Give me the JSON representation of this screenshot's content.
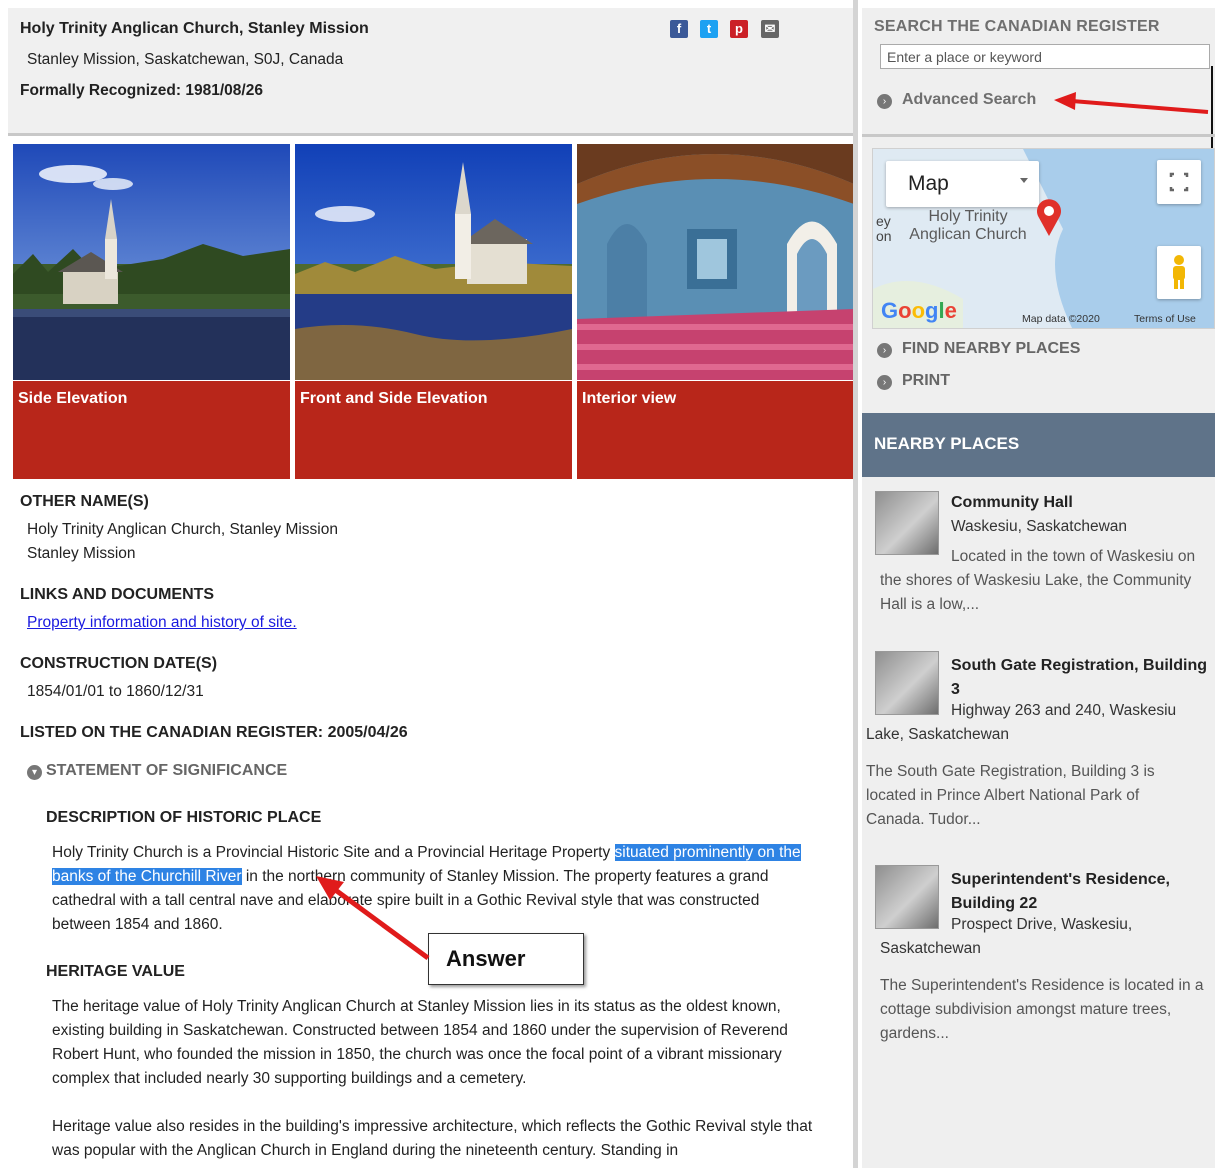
{
  "header": {
    "title": "Holy Trinity Anglican Church, Stanley Mission",
    "address": "Stanley Mission, Saskatchewan, S0J, Canada",
    "recognized": "Formally Recognized: 1981/08/26",
    "share_icons": [
      "facebook-icon",
      "twitter-icon",
      "pinterest-icon",
      "email-icon"
    ],
    "share_glyphs": {
      "facebook": "f",
      "twitter": "t",
      "pinterest": "p",
      "email": "✉"
    },
    "share_colors": {
      "facebook": "#3b5998",
      "twitter": "#1da1f2",
      "pinterest": "#cb2027",
      "email": "#666666"
    }
  },
  "images": [
    {
      "caption": "Side Elevation"
    },
    {
      "caption": "Front and Side Elevation"
    },
    {
      "caption": "Interior view"
    }
  ],
  "details": {
    "other_names_heading": "OTHER NAME(S)",
    "other_names": [
      "Holy Trinity Anglican Church, Stanley Mission",
      "Stanley Mission"
    ],
    "links_heading": "LINKS AND DOCUMENTS",
    "link_text": "Property information and history of site.",
    "construction_heading": "CONSTRUCTION DATE(S)",
    "construction_value": "1854/01/01 to 1860/12/31",
    "listed": "LISTED ON THE CANADIAN REGISTER: 2005/04/26",
    "statement_toggle": "STATEMENT OF SIGNIFICANCE",
    "description_heading": "DESCRIPTION OF HISTORIC PLACE",
    "description_before": "Holy Trinity Church is a Provincial Historic Site and a Provincial Heritage Property ",
    "description_highlight": "situated prominently on the banks of the Churchill River",
    "description_after": " in the northern community of Stanley Mission. The property features a grand cathedral with a tall central nave and elaborate spire built in a Gothic Revival style that was constructed between 1854 and 1860.",
    "heritage_heading": "HERITAGE VALUE",
    "heritage_p1": "The heritage value of Holy Trinity Anglican Church at Stanley Mission lies in its status as the oldest known, existing building in Saskatchewan. Constructed between 1854 and 1860 under the supervision of Reverend Robert Hunt, who founded the mission in 1850, the church was once the focal point of a vibrant missionary complex that included nearly 30 supporting buildings and a cemetery.",
    "heritage_p2": "Heritage value also resides in the building's impressive architecture, which reflects the Gothic Revival style that was popular with the Anglican Church in England during the nineteenth century. Standing in"
  },
  "annotation": {
    "label": "Answer",
    "arrow_color": "#e01b1b"
  },
  "sidebar": {
    "search_heading": "SEARCH THE CANADIAN REGISTER",
    "search_placeholder": "Enter a place or keyword",
    "advanced_search": "Advanced Search",
    "map": {
      "type_label": "Map",
      "place_label": "Holy Trinity Anglican Church",
      "edge_text": "ey\non",
      "google": "Google",
      "map_data": "Map data ©2020",
      "terms": "Terms of Use"
    },
    "find_nearby": "FIND NEARBY PLACES",
    "print": "PRINT",
    "nearby_heading": "NEARBY PLACES",
    "nearby": [
      {
        "title": "Community Hall",
        "location": "Waskesiu, Saskatchewan",
        "desc": "Located in the town of Waskesiu on the shores of Waskesiu Lake, the Community Hall is a low,..."
      },
      {
        "title": "South Gate Registration, Building 3",
        "location": "Highway 263 and 240, Waskesiu Lake, Saskatchewan",
        "desc": "The South Gate Registration, Building 3 is located in Prince Albert National Park of Canada. Tudor..."
      },
      {
        "title": "Superintendent's Residence, Building 22",
        "location": "Prospect Drive, Waskesiu, Saskatchewan",
        "desc": "The Superintendent's Residence is located in a cottage subdivision amongst mature trees, gardens..."
      }
    ]
  }
}
